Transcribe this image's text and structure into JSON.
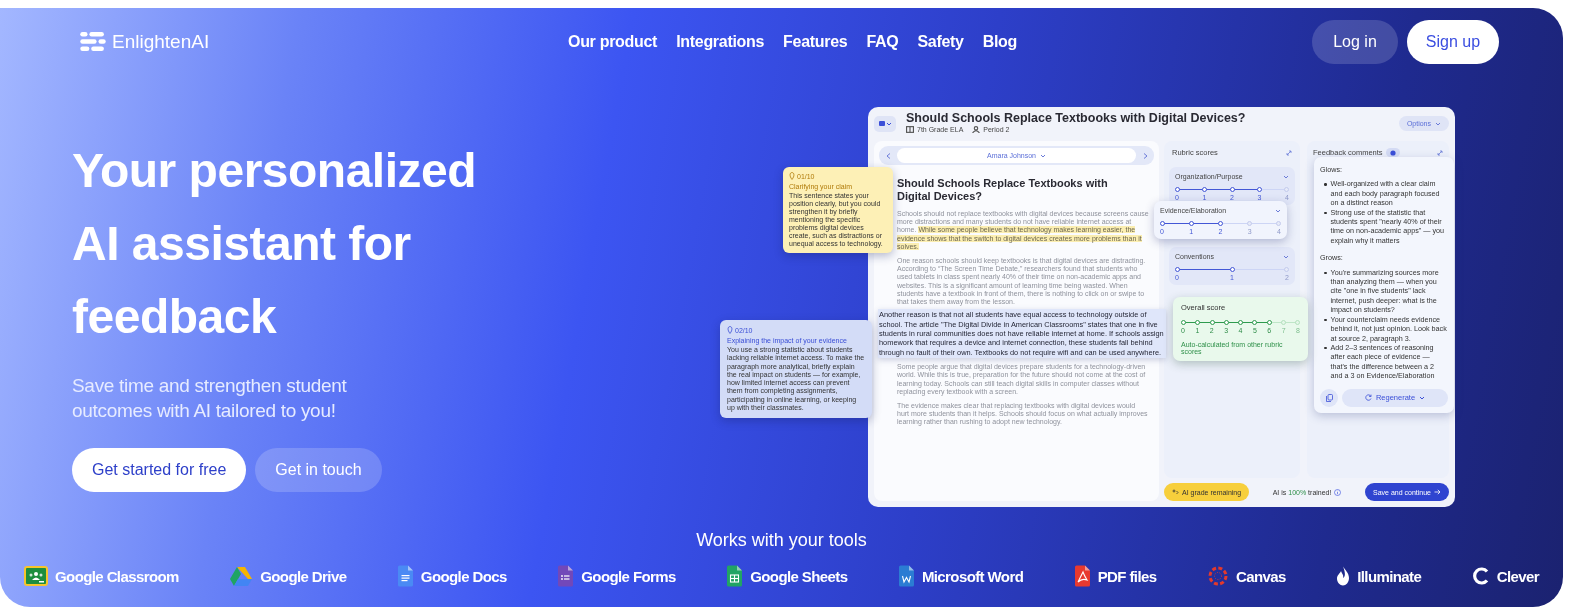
{
  "brand": {
    "name": "EnlightenAI"
  },
  "nav": [
    "Our product",
    "Integrations",
    "Features",
    "FAQ",
    "Safety",
    "Blog"
  ],
  "auth": {
    "login": "Log in",
    "signup": "Sign up"
  },
  "hero": {
    "title": "Your personalized AI assistant for feedback",
    "subtitle": "Save time and strengthen student outcomes with AI tailored to you!",
    "buttons": [
      {
        "label": "Get started for free",
        "kind": "primary"
      },
      {
        "label": "Get in touch",
        "kind": "secondary"
      }
    ]
  },
  "mockup": {
    "title": "Should Schools Replace Textbooks with Digital Devices?",
    "grade": "7th Grade ELA",
    "period": "Period 2",
    "options": "Options",
    "student": "Amara Johnson",
    "essay": {
      "title": "Should Schools Replace Textbooks with Digital Devices?",
      "paragraphs": [
        {
          "selected": false,
          "segments": [
            {
              "text": "Schools should not replace textbooks with digital devices because screens cause more distractions and many students do not have reliable internet access at home.",
              "highlighted": false
            },
            {
              "text": "While some people believe that technology makes learning easier, the evidence shows that the switch to digital devices creates more problems than it solves.",
              "highlighted": true
            }
          ]
        },
        {
          "selected": false,
          "segments": [
            {
              "text": "One reason schools should keep textbooks is that digital devices are distracting. According to “The Screen Time Debate,” researchers found that students who used tablets in class spent nearly 40% of their time on non-academic apps and websites. This is a significant amount of learning time being wasted. When students have a textbook in front of them, there is nothing to click on or swipe to that takes them away from the lesson.",
              "highlighted": false
            }
          ]
        },
        {
          "selected": true,
          "segments": [
            {
              "text": "Another reason is that not all students have equal access to technology outside of school. The article \"The Digital Divide in American Classrooms\" states that one in five students in rural communities does not have reliable internet at home. If schools assign homework that requires a device and internet connection, these students fall behind through no fault of their own. Textbooks do not require wifi and can be used anywhere.",
              "highlighted": false
            }
          ]
        },
        {
          "selected": false,
          "segments": [
            {
              "text": "Some people argue that digital devices prepare students for a technology-driven world. While this is true, preparation for the future should not come at the cost of learning today. Schools can still teach digital skills in computer classes without replacing every textbook with a screen.",
              "highlighted": false
            }
          ]
        },
        {
          "selected": false,
          "segments": [
            {
              "text": "The evidence makes clear that replacing textbooks with digital devices would hurt more students than it helps. Schools should focus on what actually improves learning rather than rushing to adopt new technology.",
              "highlighted": false
            }
          ]
        }
      ]
    },
    "notes": [
      {
        "number": "01/10",
        "title": "Clarifying your claim",
        "text": "This sentence states your position clearly, but you could strengthen it by briefly mentioning the specific problems digital devices create, such as distractions or unequal access to technology.",
        "color": "#fdf0b6"
      },
      {
        "number": "02/10",
        "title": "Explaining the impact of your evidence",
        "text": "You use a strong statistic about students lacking reliable internet access. To make the paragraph more analytical, briefly explain the real impact on students — for example, how limited internet access can prevent them from completing assignments, participating in online learning, or keeping up with their classmates.",
        "color": "#d3dcf7"
      }
    ],
    "rubric": {
      "title": "Rubric scores",
      "criteria": [
        {
          "name": "Organization/Purpose",
          "raised": false,
          "level": 0.75,
          "ticks": [
            "0",
            "1",
            "2",
            "3",
            "4"
          ]
        },
        {
          "name": "Evidence/Elaboration",
          "raised": true,
          "level": 0.5,
          "ticks": [
            "0",
            "1",
            "2",
            "3",
            "4"
          ]
        },
        {
          "name": "Conventions",
          "raised": false,
          "level": 0.5,
          "ticks": [
            "0",
            "1",
            "2"
          ]
        }
      ]
    },
    "overall": {
      "title": "Overall score",
      "level": 0.75,
      "ticks": [
        "0",
        "1",
        "2",
        "3",
        "4",
        "5",
        "6",
        "7",
        "8"
      ],
      "note": "Auto-calculated from other rubric scores"
    },
    "feedback": {
      "title": "Feedback comments",
      "sections": [
        {
          "heading": "Glows:",
          "items": [
            "Well-organized with a clear claim and each body paragraph focused on a distinct reason",
            "Strong use of the statistic that students spent \"nearly 40% of their time on non-academic apps\" — you explain why it matters"
          ]
        },
        {
          "heading": "Grows:",
          "items": [
            "You're summarizing sources more than analyzing them — when you cite \"one in five students\" lack internet, push deeper: what is the impact on students?",
            "Your counterclaim needs evidence behind it, not just opinion. Look back at source 2, paragraph 3.",
            "Add 2–3 sentences of reasoning after each piece of evidence — that's the difference between a 2 and a 3 on Evidence/Elaboration"
          ]
        }
      ],
      "regenerate": "Regenerate"
    },
    "footer": {
      "remaining": "AI grade remaining",
      "status_before": "AI is",
      "percent": "100%",
      "status_after": "trained!",
      "save": "Save and continue"
    }
  },
  "tools": {
    "heading": "Works with your tools",
    "items": [
      {
        "label": "Google Classroom",
        "kind": "classroom"
      },
      {
        "label": "Google Drive",
        "kind": "drive"
      },
      {
        "label": "Google Docs",
        "kind": "docs"
      },
      {
        "label": "Google Forms",
        "kind": "forms"
      },
      {
        "label": "Google Sheets",
        "kind": "sheets"
      },
      {
        "label": "Microsoft Word",
        "kind": "word"
      },
      {
        "label": "PDF files",
        "kind": "pdf"
      },
      {
        "label": "Canvas",
        "kind": "canvas"
      },
      {
        "label": "Illuminate",
        "kind": "illuminate"
      },
      {
        "label": "Clever",
        "kind": "clever"
      }
    ]
  }
}
